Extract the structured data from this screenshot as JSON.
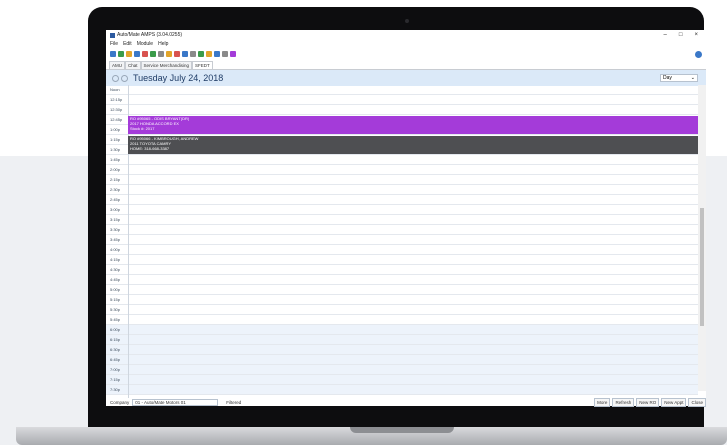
{
  "window": {
    "title": "Auto/Mate AMPS (3.04.0255)"
  },
  "menu": [
    "File",
    "Edit",
    "Module",
    "Help"
  ],
  "tabs": [
    "AMU",
    "Chat",
    "Service Merchandising",
    "SFEDT"
  ],
  "date_title": "Tuesday July 24, 2018",
  "view_select": "Day",
  "times": [
    "Noon",
    "12:15p",
    "12:30p",
    "12:45p",
    "1:00p",
    "1:15p",
    "1:30p",
    "1:45p",
    "2:00p",
    "2:15p",
    "2:30p",
    "2:45p",
    "3:00p",
    "3:15p",
    "3:30p",
    "3:45p",
    "4:00p",
    "4:15p",
    "4:30p",
    "4:45p",
    "5:00p",
    "5:15p",
    "5:30p",
    "5:45p",
    "6:00p",
    "6:15p",
    "6:30p",
    "6:45p",
    "7:00p",
    "7:15p",
    "7:30p"
  ],
  "appointments": [
    {
      "lines": [
        "RO #95065 - ODIS BRYANT(DR)",
        "2017 HONDA ACCORD EX",
        "Stock #: 2017"
      ],
      "color": "#a43bd9"
    },
    {
      "lines": [
        "RO #95066 - KIMBROUGH, ANDREW",
        "2011 TOYOTA CAMRY",
        "HOME: 318-668-3387"
      ],
      "color": "#4e4f52"
    }
  ],
  "footer": {
    "company_label": "Company",
    "company_value": "01 - Auto/Mate Motors 01",
    "filtered": "Filtered",
    "buttons": [
      "More",
      "Refresh",
      "New RO",
      "New Appt",
      "Close"
    ]
  },
  "toolbar_icons": [
    "grid-icon",
    "users-icon",
    "chart-icon",
    "person-icon",
    "car-icon",
    "parts-icon",
    "clock-icon",
    "money-icon",
    "lock-icon",
    "mail-icon",
    "print-icon",
    "tools-icon",
    "key-icon",
    "report-icon",
    "calendar-icon",
    "filter-icon",
    "help-icon"
  ],
  "colors": {
    "accent": "#a43bd9",
    "header_bg": "#dbe9f8",
    "date_text": "#1f3c66"
  }
}
